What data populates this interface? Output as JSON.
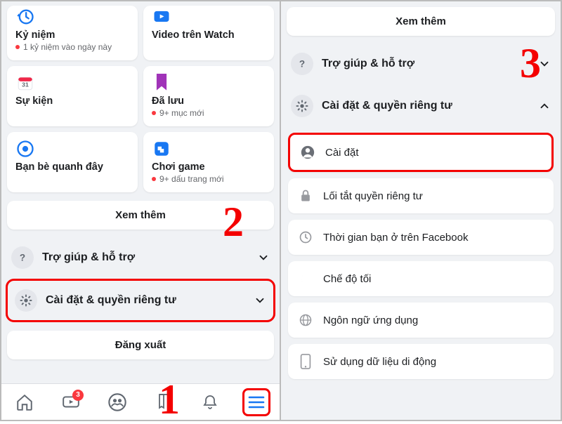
{
  "left": {
    "cards": [
      {
        "title": "Kỷ niệm",
        "sub": "1 kỷ niệm vào ngày này"
      },
      {
        "title": "Video trên Watch",
        "sub": ""
      },
      {
        "title": "Sự kiện",
        "sub": ""
      },
      {
        "title": "Đã lưu",
        "sub": "9+ mục mới"
      },
      {
        "title": "Bạn bè quanh đây",
        "sub": ""
      },
      {
        "title": "Chơi game",
        "sub": "9+ dấu trang mới"
      }
    ],
    "more": "Xem thêm",
    "help": "Trợ giúp & hỗ trợ",
    "settings": "Cài đặt & quyền riêng tư",
    "logout": "Đăng xuất",
    "badge": "3"
  },
  "right": {
    "more": "Xem thêm",
    "help": "Trợ giúp & hỗ trợ",
    "settings": "Cài đặt & quyền riêng tư",
    "opts": [
      "Cài đặt",
      "Lối tắt quyền riêng tư",
      "Thời gian bạn ở trên Facebook",
      "Chế độ tối",
      "Ngôn ngữ ứng dụng",
      "Sử dụng dữ liệu di động"
    ]
  },
  "steps": {
    "n1": "1",
    "n2": "2",
    "n3": "3"
  }
}
